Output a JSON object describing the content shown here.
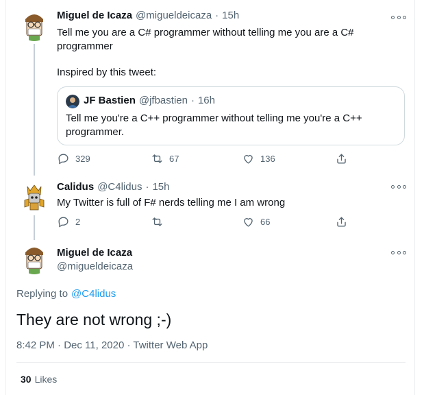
{
  "tweets": [
    {
      "name": "Miguel de Icaza",
      "handle": "@migueldeicaza",
      "time": "15h",
      "text_line1": "Tell me you are a C# programmer without telling me you are a C#",
      "text_line2": "programmer",
      "text_line3": "Inspired by this tweet:",
      "quote": {
        "name": "JF Bastien",
        "handle": "@jfbastien",
        "time": "16h",
        "text_line1": "Tell me you're a C++ programmer without telling me you're a C++",
        "text_line2": "programmer."
      },
      "replies": "329",
      "retweets": "67",
      "likes": "136"
    },
    {
      "name": "Calidus",
      "handle": "@C4lidus",
      "time": "15h",
      "text": "My Twitter is full of F# nerds telling me I am wrong",
      "replies": "2",
      "retweets": "",
      "likes": "66"
    }
  ],
  "main": {
    "name": "Miguel de Icaza",
    "handle": "@migueldeicaza",
    "replying_prefix": "Replying to",
    "replying_to": "@C4lidus",
    "text": "They are not wrong ;-)",
    "timestamp": "8:42 PM · Dec 11, 2020 · Twitter Web App",
    "likes_count": "30",
    "likes_label": "Likes"
  },
  "separator": "·",
  "icons": {
    "more": "more-icon",
    "reply": "reply-icon",
    "retweet": "retweet-icon",
    "like": "heart-icon",
    "share": "share-icon"
  },
  "colors": {
    "accent": "#1d9bf0",
    "text": "#0f1419",
    "secondary": "#536471",
    "border": "#cfd9de"
  }
}
